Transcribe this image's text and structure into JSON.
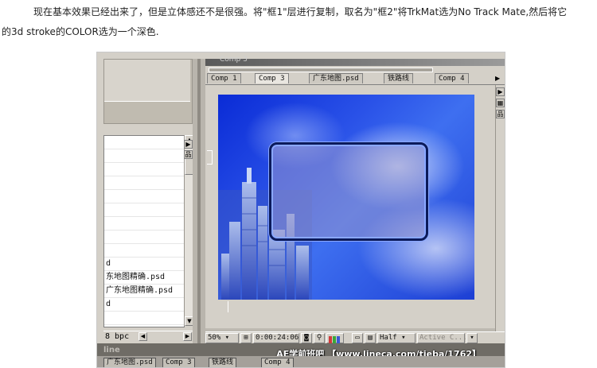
{
  "article": {
    "line1": "现在基本效果已经出来了，但是立体感还不是很强。将\"框1\"层进行复制，取名为\"框2\"将TrkMat选为No Track Mate,然后将它",
    "line2": "的3d stroke的COLOR选为一个深色."
  },
  "project_panel": {
    "rows": [
      "",
      "",
      "",
      "",
      "",
      "",
      "",
      "",
      "",
      "d",
      "东地图精确.psd",
      "广东地图精确.psd",
      "d",
      "",
      ""
    ],
    "bpc_label": "8 bpc"
  },
  "comp_window": {
    "title": "Comp 3",
    "tabs": [
      {
        "label": "Comp 1",
        "active": false
      },
      {
        "label": "Comp 3",
        "active": true
      },
      {
        "label": "广东地图.psd",
        "active": false
      },
      {
        "label": "铁路线",
        "active": false
      },
      {
        "label": "Comp 4",
        "active": false
      }
    ],
    "toolbar": {
      "zoom": "50%",
      "timecode": "0:00:24:06",
      "resolution": "Half",
      "camera": "Active C..."
    }
  },
  "timeline": {
    "label": "line",
    "tabs": [
      "广东地图.psd",
      "Comp 3",
      "铁路线",
      "Comp 4"
    ]
  },
  "watermark": "AE学前班吧 【www.lineca.com/tieba/1762】",
  "colors": {
    "ui_gray": "#d4d0c8",
    "viewer_blue": "#1d3fd4",
    "frame_border": "#0b1a5a"
  }
}
